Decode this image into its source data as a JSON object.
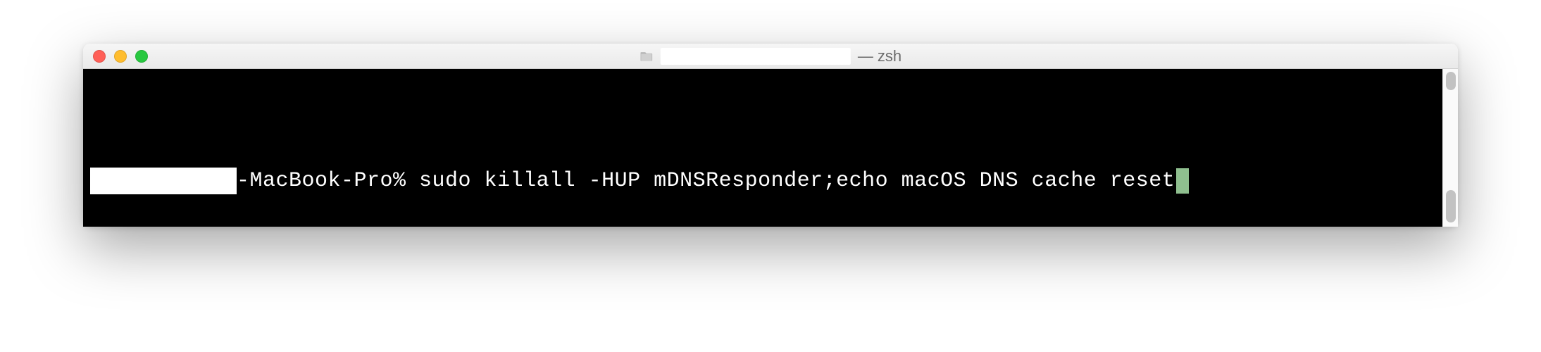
{
  "titlebar": {
    "process_label": " — zsh"
  },
  "terminal": {
    "prompt_host_suffix": "-MacBook-Pro% ",
    "command": "sudo killall -HUP mDNSResponder;echo macOS DNS cache reset"
  }
}
